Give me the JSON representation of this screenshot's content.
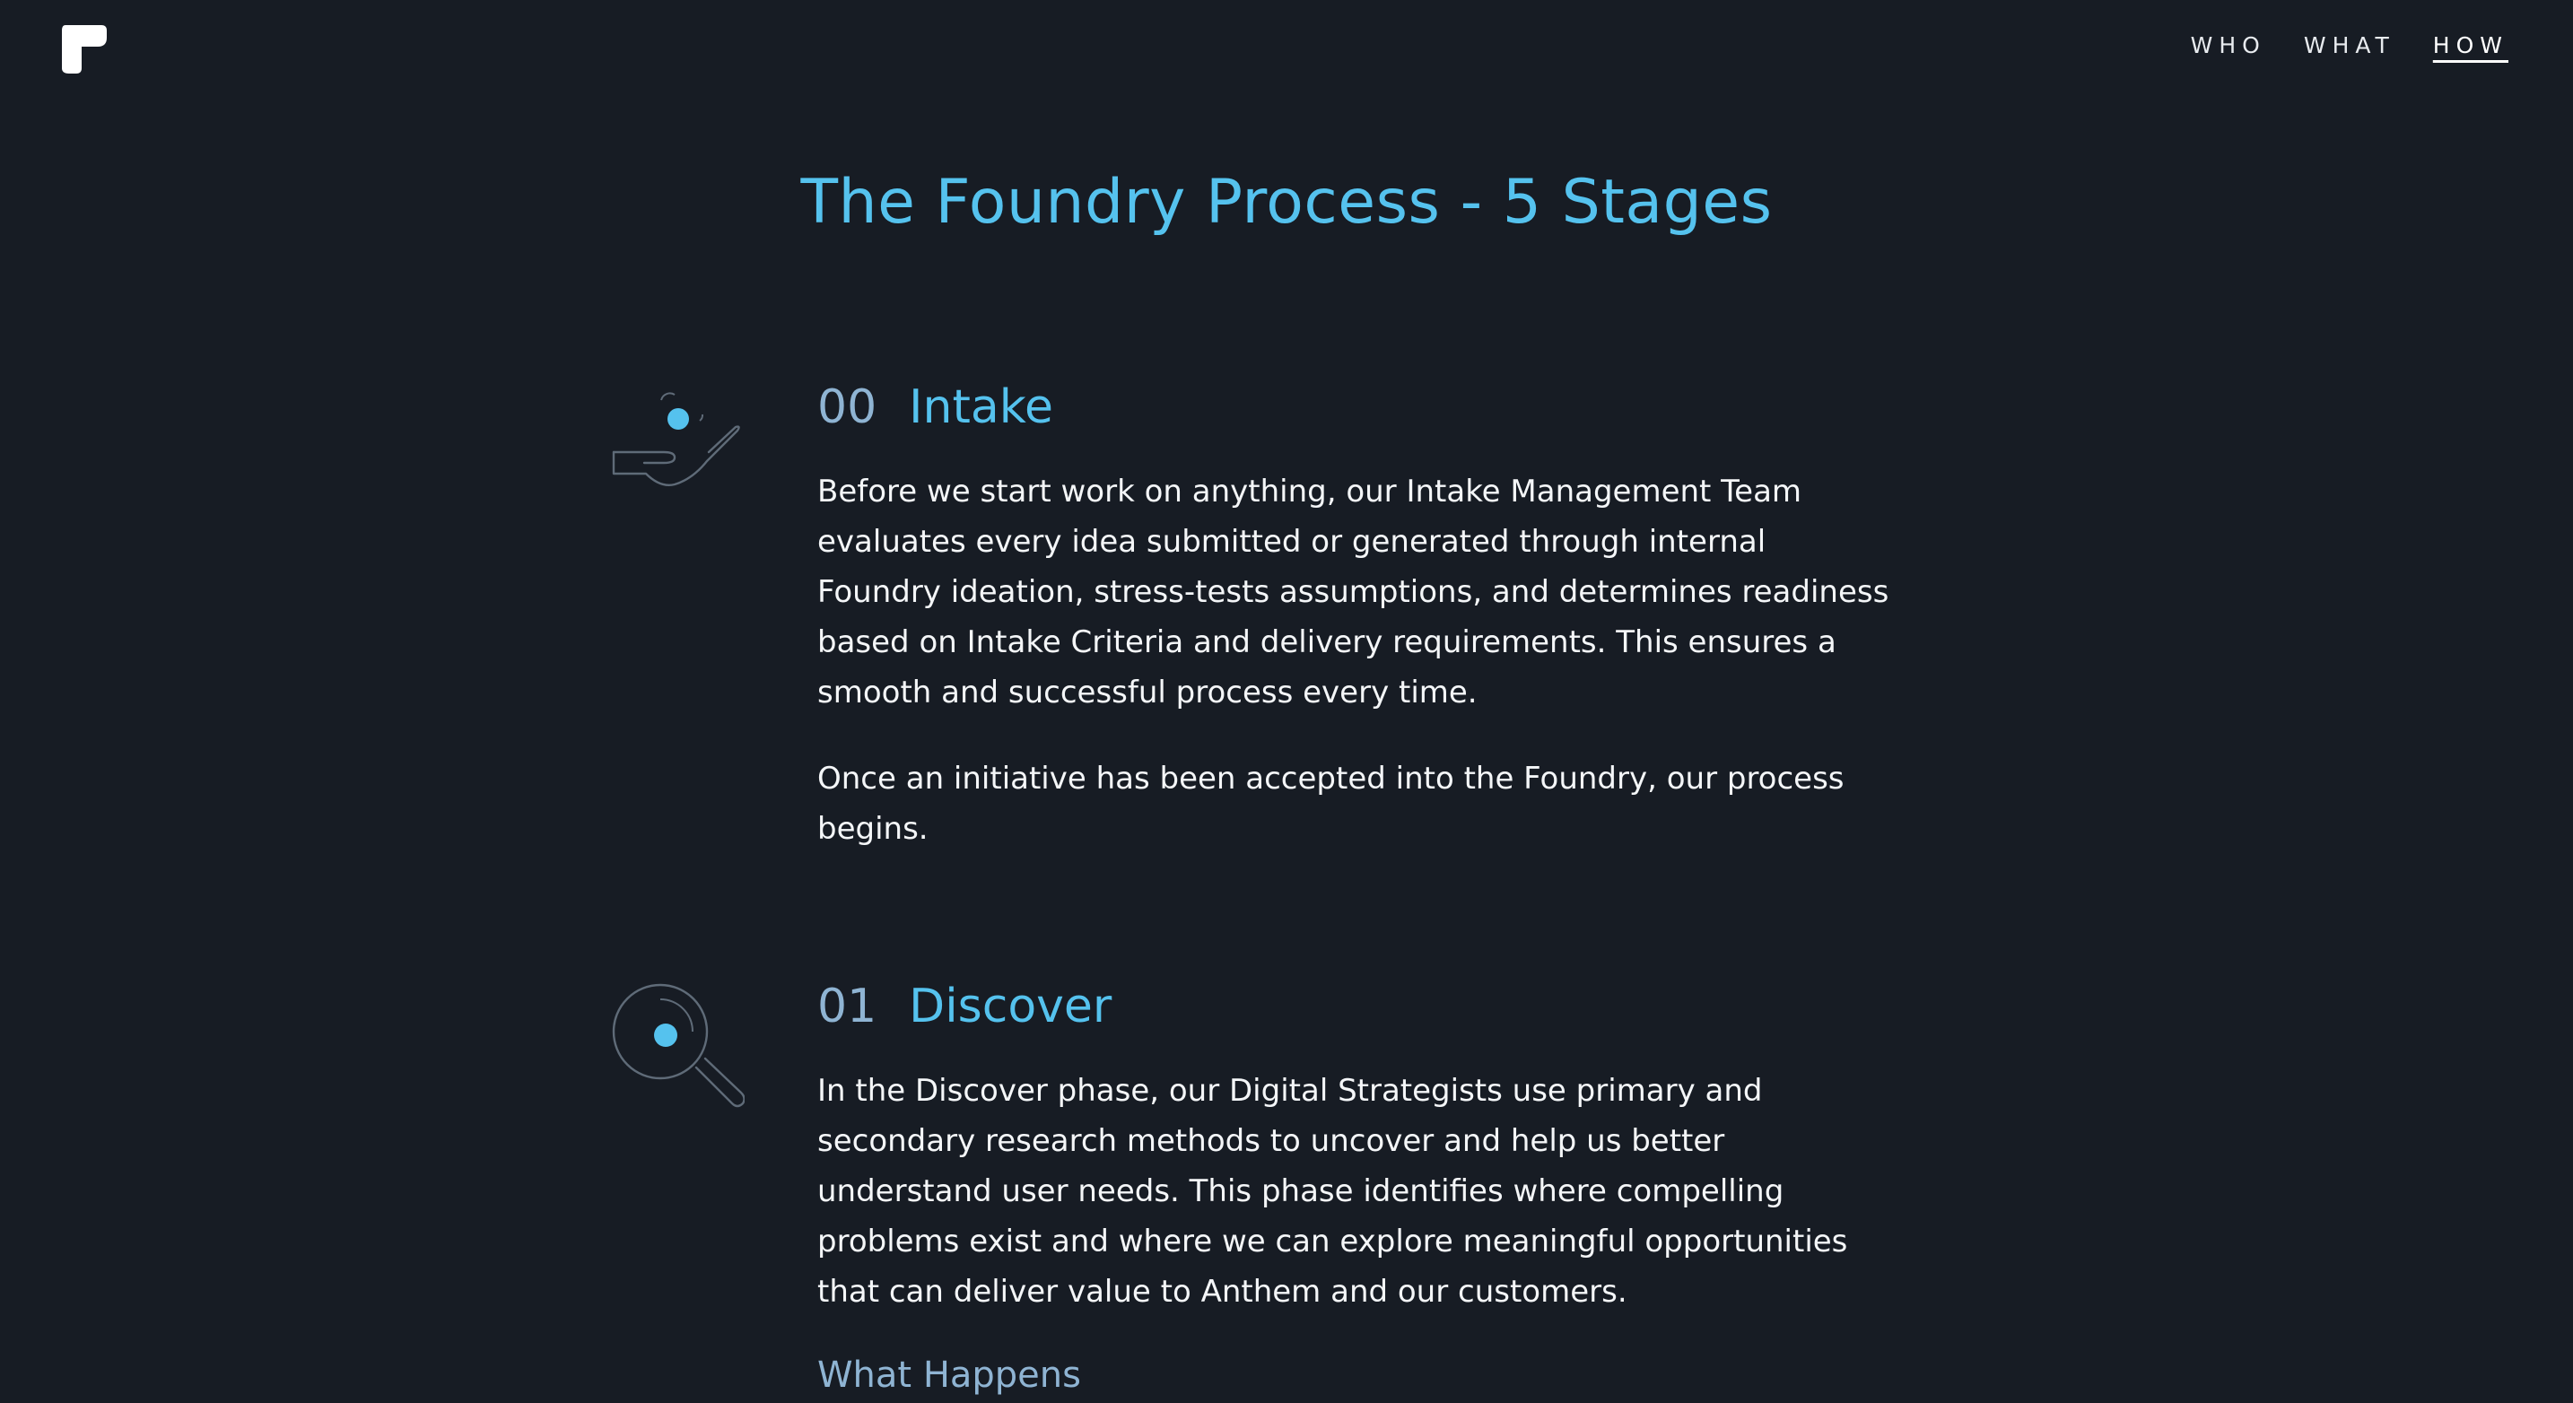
{
  "header": {
    "logo_icon": "foundry-f-logo",
    "nav": [
      {
        "label": "WHO",
        "active": false
      },
      {
        "label": "WHAT",
        "active": false
      },
      {
        "label": "HOW",
        "active": true
      }
    ]
  },
  "page": {
    "title": "The Foundry Process - 5 Stages"
  },
  "stages": [
    {
      "number": "00",
      "name": "Intake",
      "icon": "hand-holding-dot-icon",
      "paragraphs": [
        "Before we start work on anything, our Intake Management Team evaluates every idea submitted or generated through internal Foundry ideation, stress-tests assumptions, and determines readiness based on Intake Criteria and delivery requirements. This ensures a smooth and successful process every time.",
        "Once an initiative has been accepted into the Foundry, our process begins."
      ]
    },
    {
      "number": "01",
      "name": "Discover",
      "icon": "magnifier-icon",
      "paragraphs": [
        "In the Discover phase, our Digital Strategists use primary and secondary research methods to uncover and help us better understand user needs. This phase identifies where compelling problems exist and where we can explore meaningful opportunities that can deliver value to Anthem and our customers."
      ],
      "subheading": "What Happens"
    }
  ],
  "colors": {
    "background": "#171c24",
    "accent": "#55c2ee",
    "number": "#8fb4d3",
    "text": "#f4f6f8",
    "icon_stroke": "#5f6b78"
  }
}
